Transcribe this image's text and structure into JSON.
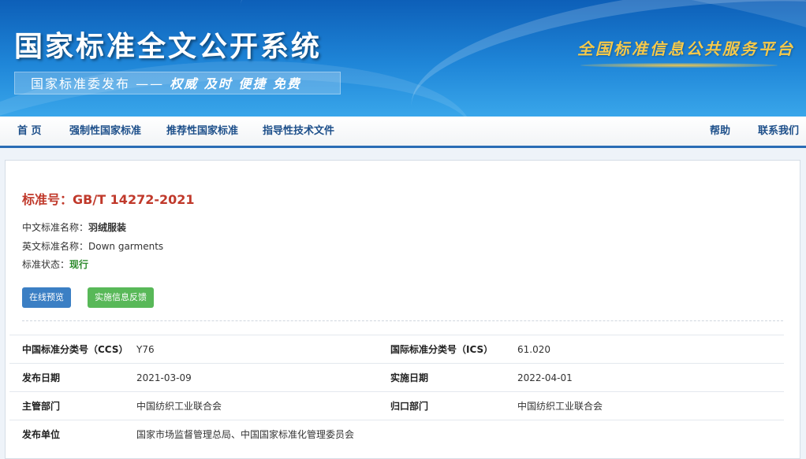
{
  "header": {
    "site_title": "国家标准全文公开系统",
    "slogan_left": "国家标准委发布 —— ",
    "slogan_right": "权威 及时 便捷 免费",
    "platform_text": "全国标准信息公共服务平台"
  },
  "nav": {
    "home": "首 页",
    "mandatory": "强制性国家标准",
    "recommended": "推荐性国家标准",
    "guidance": "指导性技术文件",
    "help": "帮助",
    "contact": "联系我们"
  },
  "standard": {
    "number_label": "标准号：",
    "number": "GB/T 14272-2021",
    "cn_name_label": "中文标准名称：",
    "cn_name": "羽绒服装",
    "en_name_label": "英文标准名称：",
    "en_name": "Down garments",
    "status_label": "标准状态：",
    "status": "现行",
    "status_color": "#2e8b2e"
  },
  "buttons": {
    "preview": "在线预览",
    "feedback": "实施信息反馈"
  },
  "details": {
    "ccs_label": "中国标准分类号（CCS）",
    "ccs": "Y76",
    "ics_label": "国际标准分类号（ICS）",
    "ics": "61.020",
    "publish_date_label": "发布日期",
    "publish_date": "2021-03-09",
    "implement_date_label": "实施日期",
    "implement_date": "2022-04-01",
    "competent_label": "主管部门",
    "competent": "中国纺织工业联合会",
    "centralized_label": "归口部门",
    "centralized": "中国纺织工业联合会",
    "publisher_label": "发布单位",
    "publisher": "国家市场监督管理总局、中国国家标准化管理委员会"
  },
  "colors": {
    "accent": "#2a6db5",
    "standard_number": "#c0392b",
    "btn_blue": "#3b7fc4",
    "btn_green": "#58b858"
  }
}
